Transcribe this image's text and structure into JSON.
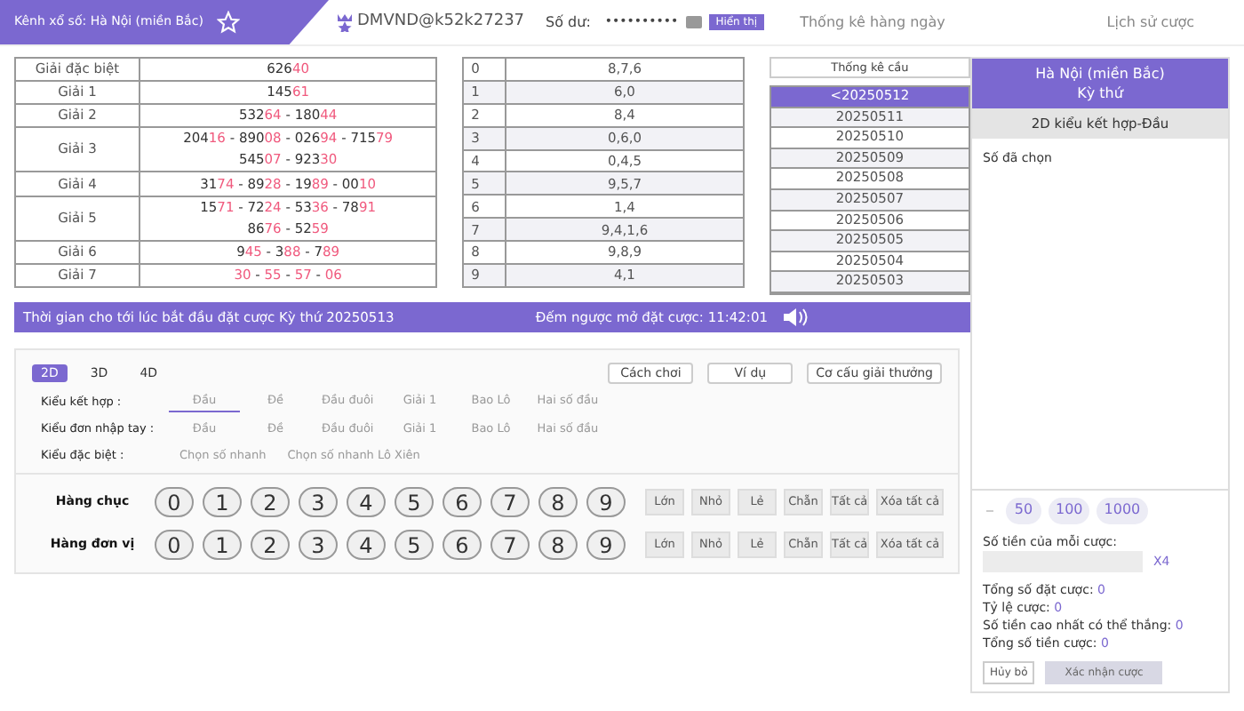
{
  "header": {
    "channel_label": "Kênh xổ số:",
    "channel": "Hà Nội (miền Bắc)",
    "username": "DMVND@k52k27237",
    "balance_label": "Số dư:",
    "balance": "••••••••••",
    "show_button": "Hiển thị",
    "links": [
      "Thống kê hàng ngày",
      "Lịch sử cược"
    ]
  },
  "prize_separator": "-",
  "prizes": [
    {
      "name": "Giải đặc biệt",
      "lines": [
        [
          "62640"
        ]
      ]
    },
    {
      "name": "Giải 1",
      "lines": [
        [
          "14561"
        ]
      ]
    },
    {
      "name": "Giải 2",
      "lines": [
        [
          "53264",
          "18044"
        ]
      ]
    },
    {
      "name": "Giải 3",
      "lines": [
        [
          "20416",
          "89008",
          "02694",
          "71579"
        ],
        [
          "54507",
          "92330"
        ]
      ]
    },
    {
      "name": "Giải 4",
      "lines": [
        [
          "3174",
          "8928",
          "1989",
          "0010"
        ]
      ]
    },
    {
      "name": "Giải 5",
      "lines": [
        [
          "1571",
          "7224",
          "5336",
          "7891"
        ],
        [
          "8676",
          "5259"
        ]
      ]
    },
    {
      "name": "Giải 6",
      "lines": [
        [
          "945",
          "388",
          "789"
        ]
      ]
    },
    {
      "name": "Giải 7",
      "lines": [
        [
          "30",
          "55",
          "57",
          "06"
        ]
      ]
    }
  ],
  "head_tail": [
    {
      "digit": "0",
      "values": "8,7,6"
    },
    {
      "digit": "1",
      "values": "6,0"
    },
    {
      "digit": "2",
      "values": "8,4"
    },
    {
      "digit": "3",
      "values": "0,6,0"
    },
    {
      "digit": "4",
      "values": "0,4,5"
    },
    {
      "digit": "5",
      "values": "9,5,7"
    },
    {
      "digit": "6",
      "values": "1,4"
    },
    {
      "digit": "7",
      "values": "9,4,1,6"
    },
    {
      "digit": "8",
      "values": "9,8,9"
    },
    {
      "digit": "9",
      "values": "4,1"
    }
  ],
  "stats": {
    "title": "Thống kê cầu",
    "dates": [
      {
        "label": "<20250512",
        "selected": true
      },
      {
        "label": "20250511",
        "selected": false
      },
      {
        "label": "20250510",
        "selected": false
      },
      {
        "label": "20250509",
        "selected": false
      },
      {
        "label": "20250508",
        "selected": false
      },
      {
        "label": "20250507",
        "selected": false
      },
      {
        "label": "20250506",
        "selected": false
      },
      {
        "label": "20250505",
        "selected": false
      },
      {
        "label": "20250504",
        "selected": false
      },
      {
        "label": "20250503",
        "selected": false
      }
    ]
  },
  "countdown": {
    "text": "Thời gian cho tới lúc bắt đầu đặt cược Kỳ thứ 20250513",
    "timer": "Đếm ngược mở đặt cược: 11:42:01"
  },
  "game": {
    "modes": [
      {
        "label": "2D",
        "selected": true
      },
      {
        "label": "3D",
        "selected": false
      },
      {
        "label": "4D",
        "selected": false
      }
    ],
    "buttons": [
      "Cách chơi",
      "Ví dụ",
      "Cơ cấu giải thưởng"
    ],
    "bet_types": [
      {
        "label": "Kiểu kết hợp :",
        "options": [
          {
            "label": "Đầu",
            "selected": true
          },
          {
            "label": "Đề",
            "selected": false
          },
          {
            "label": "Đầu đuôi",
            "selected": false
          },
          {
            "label": "Giải 1",
            "selected": false
          },
          {
            "label": "Bao Lô",
            "selected": false
          },
          {
            "label": "Hai số đầu",
            "selected": false
          }
        ]
      },
      {
        "label": "Kiểu đơn nhập tay :",
        "options": [
          {
            "label": "Đầu",
            "selected": false
          },
          {
            "label": "Đề",
            "selected": false
          },
          {
            "label": "Đầu đuôi",
            "selected": false
          },
          {
            "label": "Giải 1",
            "selected": false
          },
          {
            "label": "Bao Lô",
            "selected": false
          },
          {
            "label": "Hai số đầu",
            "selected": false
          }
        ]
      },
      {
        "label": "Kiểu đặc biệt :",
        "options": [
          {
            "label": "Chọn số nhanh",
            "selected": false
          },
          {
            "label": "Chọn số nhanh Lô Xiên",
            "selected": false
          }
        ]
      }
    ],
    "rows": [
      {
        "label": "Hàng chục",
        "digits": [
          "0",
          "1",
          "2",
          "3",
          "4",
          "5",
          "6",
          "7",
          "8",
          "9"
        ],
        "actions": [
          "Lớn",
          "Nhỏ",
          "Lẻ",
          "Chẵn",
          "Tất cả",
          "Xóa tất cả"
        ]
      },
      {
        "label": "Hàng đơn vị",
        "digits": [
          "0",
          "1",
          "2",
          "3",
          "4",
          "5",
          "6",
          "7",
          "8",
          "9"
        ],
        "actions": [
          "Lớn",
          "Nhỏ",
          "Lẻ",
          "Chẵn",
          "Tất cả",
          "Xóa tất cả"
        ]
      }
    ]
  },
  "side": {
    "title": "Hà Nội (miền Bắc)",
    "subtitle": "Kỳ thứ",
    "mode": "2D kiểu kết hợp-Đầu",
    "selected_label": "Số đã chọn",
    "chips": [
      "50",
      "100",
      "1000"
    ],
    "amount_label": "Số tiền của mỗi cược:",
    "multiplier": "X4",
    "totals": [
      {
        "label": "Tổng số đặt cược:",
        "value": "0"
      },
      {
        "label": "Tỷ lệ cược:",
        "value": "0"
      },
      {
        "label": "Số tiền cao nhất có thể thắng:",
        "value": "0"
      },
      {
        "label": "Tổng số tiền cược:",
        "value": "0"
      }
    ],
    "cancel": "Hủy bỏ",
    "confirm": "Xác nhận cược"
  }
}
